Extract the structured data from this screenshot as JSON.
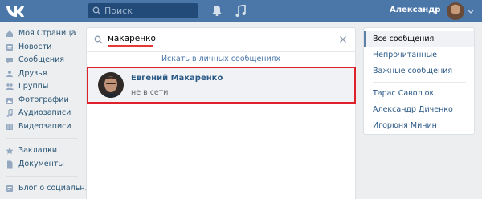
{
  "header": {
    "search_placeholder": "Поиск",
    "username": "Александр",
    "colors": {
      "bar": "#4a76a8",
      "search_bg": "#224b7a"
    }
  },
  "menu": {
    "items": [
      {
        "label": "Моя Страница",
        "icon": "home-icon"
      },
      {
        "label": "Новости",
        "icon": "news-icon"
      },
      {
        "label": "Сообщения",
        "icon": "messages-icon"
      },
      {
        "label": "Друзья",
        "icon": "friends-icon"
      },
      {
        "label": "Группы",
        "icon": "groups-icon"
      },
      {
        "label": "Фотографии",
        "icon": "photos-icon"
      },
      {
        "label": "Аудиозаписи",
        "icon": "music-icon"
      },
      {
        "label": "Видеозаписи",
        "icon": "video-icon"
      }
    ],
    "items2": [
      {
        "label": "Закладки",
        "icon": "star-icon"
      },
      {
        "label": "Документы",
        "icon": "document-icon"
      }
    ],
    "items3": [
      {
        "label": "Блог о социальн..",
        "icon": "blog-icon"
      }
    ]
  },
  "messages_search": {
    "query": "макаренко",
    "hint": "Искать в личных сообщениях",
    "result": {
      "name": "Евгений Макаренко",
      "status": "не в сети"
    },
    "highlight_color": "#e0202a"
  },
  "filters": {
    "items": [
      "Все сообщения",
      "Непрочитанные",
      "Важные сообщения"
    ],
    "active": "Все сообщения",
    "people": [
      "Тарас Савол ок",
      "Александр Диченко",
      "Игорюня Минин"
    ]
  }
}
